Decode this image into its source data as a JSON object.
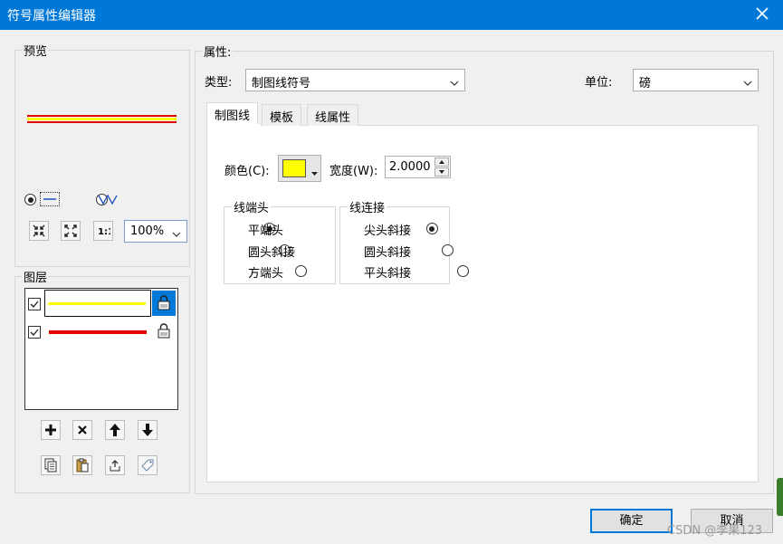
{
  "window": {
    "title": "符号属性编辑器"
  },
  "preview": {
    "label": "预览",
    "line_colors": [
      "#ffff00",
      "#e00000"
    ],
    "zoom_value": "100%"
  },
  "layers": {
    "label": "图层",
    "items": [
      {
        "checked": true,
        "color": "#ffff00",
        "selected": true
      },
      {
        "checked": true,
        "color": "#e00000",
        "selected": false
      }
    ]
  },
  "properties": {
    "label": "属性:",
    "type_label": "类型:",
    "type_value": "制图线符号",
    "unit_label": "单位:",
    "unit_value": "磅",
    "tabs": [
      "制图线",
      "模板",
      "线属性"
    ],
    "color_label": "颜色(C):",
    "color_value": "#ffff00",
    "width_label": "宽度(W):",
    "width_value": "2.0000",
    "line_cap": {
      "label": "线端头",
      "options": [
        "平端头",
        "圆头斜接",
        "方端头"
      ],
      "selected_index": 0
    },
    "line_join": {
      "label": "线连接",
      "options": [
        "尖头斜接",
        "圆头斜接",
        "平头斜接"
      ],
      "selected_index": 0
    }
  },
  "buttons": {
    "ok": "确定",
    "cancel": "取消"
  },
  "watermark": "CSDN @李果123"
}
